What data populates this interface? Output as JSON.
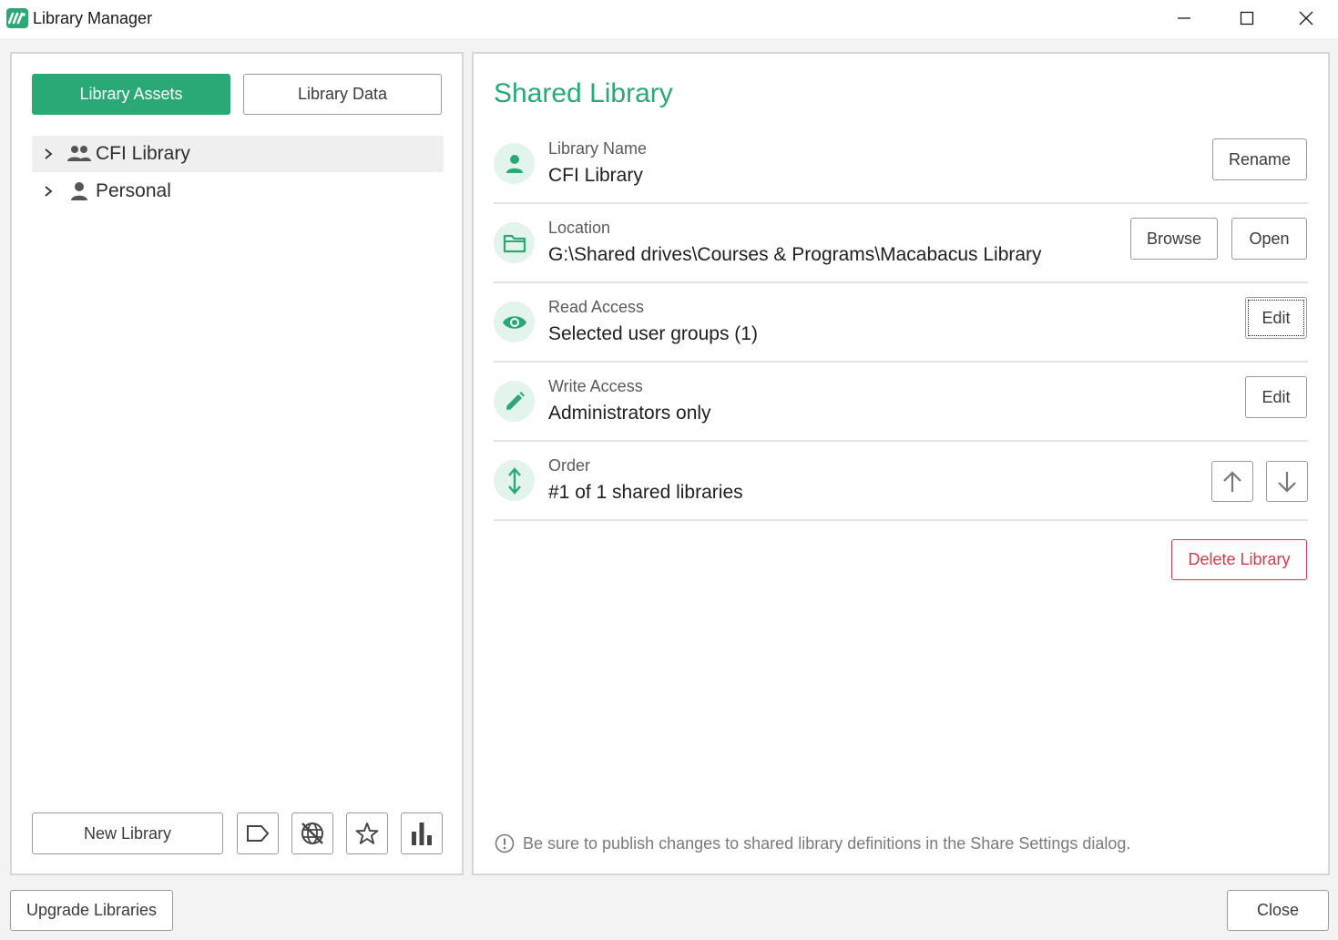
{
  "window": {
    "title": "Library Manager",
    "app_icon": "macabacus-logo-icon",
    "controls": [
      "minimize-icon",
      "maximize-icon",
      "close-icon"
    ]
  },
  "colors": {
    "accent": "#2aa876",
    "accent_light": "#e3f4ec",
    "danger": "#d63a4a"
  },
  "left_panel": {
    "tabs": [
      {
        "label": "Library Assets",
        "active": true
      },
      {
        "label": "Library Data",
        "active": false
      }
    ],
    "tree": [
      {
        "label": "CFI Library",
        "icon": "group-icon",
        "selected": true
      },
      {
        "label": "Personal",
        "icon": "person-icon",
        "selected": false
      }
    ],
    "new_library_label": "New Library",
    "tool_icons": [
      "tag-icon",
      "no-web-icon",
      "star-icon",
      "bar-chart-icon"
    ]
  },
  "right_panel": {
    "title": "Shared Library",
    "rows": [
      {
        "label": "Library Name",
        "value": "CFI Library",
        "icon": "person-icon",
        "buttons": [
          "Rename"
        ]
      },
      {
        "label": "Location",
        "value": "G:\\Shared drives\\Courses & Programs\\Macabacus Library",
        "icon": "folder-icon",
        "buttons": [
          "Browse",
          "Open"
        ]
      },
      {
        "label": "Read Access",
        "value": "Selected user groups (1)",
        "icon": "eye-icon",
        "buttons": [
          "Edit"
        ]
      },
      {
        "label": "Write Access",
        "value": "Administrators only",
        "icon": "pencil-icon",
        "buttons": [
          "Edit"
        ]
      },
      {
        "label": "Order",
        "value": "#1 of 1 shared libraries",
        "icon": "vertical-arrows-icon",
        "buttons": []
      }
    ],
    "delete_label": "Delete Library",
    "note": "Be sure to publish changes to shared library definitions in the Share Settings dialog."
  },
  "bottom_bar": {
    "upgrade_label": "Upgrade Libraries",
    "close_label": "Close"
  }
}
